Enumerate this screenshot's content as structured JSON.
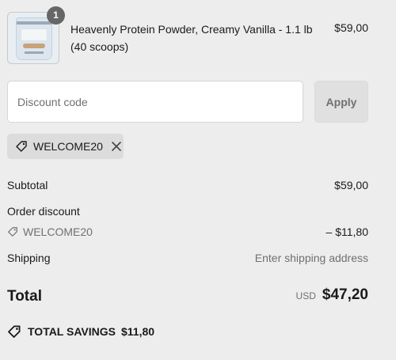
{
  "product": {
    "quantity": "1",
    "name": "Heavenly Protein Powder, Creamy Vanilla - 1.1 lb (40 scoops)",
    "price": "$59,00",
    "image_alt": "Heavenly Protein Powder bag",
    "image_label": "NUFIX"
  },
  "discount": {
    "placeholder": "Discount code",
    "value": "",
    "apply_label": "Apply"
  },
  "applied_code": {
    "label": "WELCOME20",
    "icon": "tag-icon",
    "remove_icon": "close-icon"
  },
  "summary": {
    "subtotal_label": "Subtotal",
    "subtotal_value": "$59,00",
    "order_discount_label": "Order discount",
    "discount_code": "WELCOME20",
    "discount_value": "– $11,80",
    "shipping_label": "Shipping",
    "shipping_value": "Enter shipping address",
    "total_label": "Total",
    "currency": "USD",
    "total_value": "$47,20"
  },
  "savings": {
    "label": "TOTAL SAVINGS",
    "value": "$11,80"
  },
  "colors": {
    "background": "#ededed",
    "badge": "#666666",
    "chip": "#dcdcdc",
    "muted_text": "#707070"
  }
}
